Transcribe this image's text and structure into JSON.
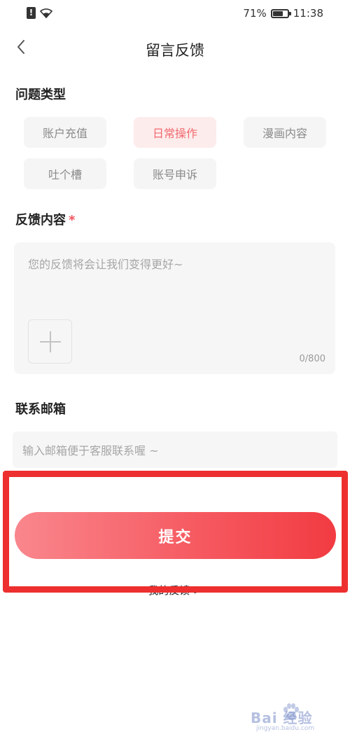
{
  "status_bar": {
    "battery_percent": "71%",
    "battery_level": 0.71,
    "time": "11:38",
    "icons": [
      "sim-alert-icon",
      "wifi-icon",
      "battery-icon"
    ]
  },
  "nav": {
    "back_icon": "chevron-left-icon",
    "title": "留言反馈"
  },
  "issue_type": {
    "title": "问题类型",
    "options": [
      {
        "label": "账户充值",
        "selected": false
      },
      {
        "label": "日常操作",
        "selected": true
      },
      {
        "label": "漫画内容",
        "selected": false
      },
      {
        "label": "吐个槽",
        "selected": false
      },
      {
        "label": "账号申诉",
        "selected": false
      }
    ]
  },
  "feedback": {
    "title": "反馈内容",
    "required_mark": "*",
    "placeholder": "您的反馈将会让我们变得更好~",
    "value": "",
    "add_image_icon": "plus-icon",
    "counter": "0/800"
  },
  "email": {
    "title": "联系邮箱",
    "placeholder": "输入邮箱便于客服联系喔 ~",
    "value": ""
  },
  "submit": {
    "label": "提交"
  },
  "my_feedback": {
    "label": "我的反馈 >"
  },
  "watermark": {
    "text": "Bai 经验",
    "url": "jingyan.baidu.com"
  },
  "colors": {
    "accent": "#f26a6f",
    "chip_selected_bg": "#fdecec",
    "chip_bg": "#f5f5f5",
    "highlight_frame": "#ed2f2f",
    "submit_gradient_start": "#f9878d",
    "submit_gradient_end": "#f23b42"
  }
}
